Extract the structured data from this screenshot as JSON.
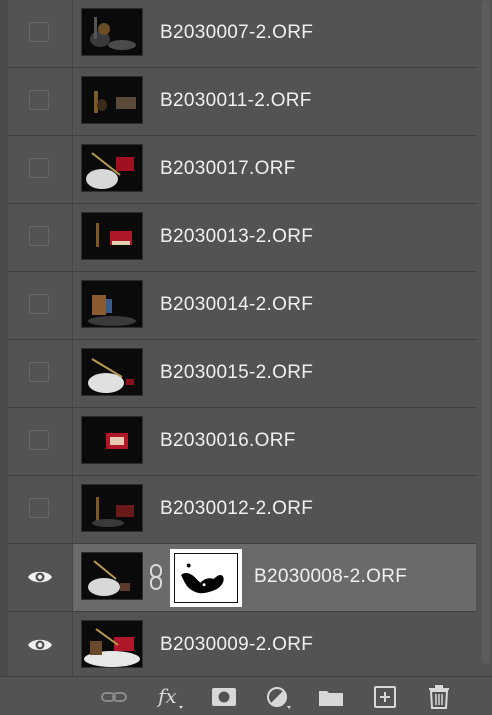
{
  "layers": [
    {
      "name": "B2030007-2.ORF",
      "visible": false,
      "selected": false,
      "has_mask": false
    },
    {
      "name": "B2030011-2.ORF",
      "visible": false,
      "selected": false,
      "has_mask": false
    },
    {
      "name": "B2030017.ORF",
      "visible": false,
      "selected": false,
      "has_mask": false
    },
    {
      "name": "B2030013-2.ORF",
      "visible": false,
      "selected": false,
      "has_mask": false
    },
    {
      "name": "B2030014-2.ORF",
      "visible": false,
      "selected": false,
      "has_mask": false
    },
    {
      "name": "B2030015-2.ORF",
      "visible": false,
      "selected": false,
      "has_mask": false
    },
    {
      "name": "B2030016.ORF",
      "visible": false,
      "selected": false,
      "has_mask": false
    },
    {
      "name": "B2030012-2.ORF",
      "visible": false,
      "selected": false,
      "has_mask": false
    },
    {
      "name": "B2030008-2.ORF",
      "visible": true,
      "selected": true,
      "has_mask": true
    },
    {
      "name": "B2030009-2.ORF",
      "visible": true,
      "selected": false,
      "has_mask": false
    }
  ],
  "toolbar": {
    "icons": [
      "link-icon",
      "fx-icon",
      "mask-icon",
      "adjustment-icon",
      "folder-icon",
      "new-layer-icon",
      "trash-icon"
    ],
    "fx_label": "fx"
  },
  "colors": {
    "panel_bg": "#535353",
    "selected_bg": "#6a6a6a",
    "text": "#f0f0f0"
  }
}
